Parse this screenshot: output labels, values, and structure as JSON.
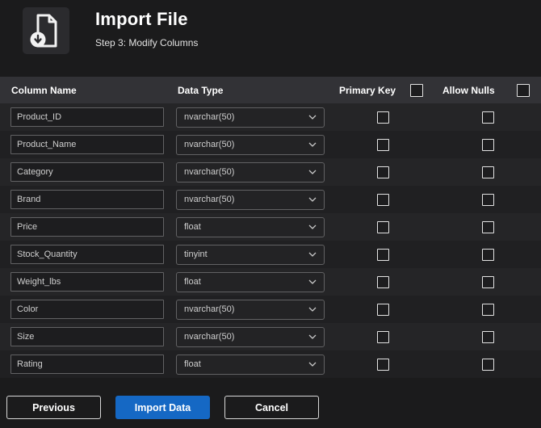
{
  "header": {
    "title": "Import File",
    "subtitle": "Step 3: Modify Columns",
    "icon": "import-file-icon"
  },
  "table": {
    "headers": {
      "column_name": "Column Name",
      "data_type": "Data Type",
      "primary_key": "Primary Key",
      "allow_nulls": "Allow Nulls"
    },
    "select_all": {
      "primary_key_checked": false,
      "allow_nulls_checked": false
    },
    "rows": [
      {
        "name": "Product_ID",
        "type": "nvarchar(50)",
        "primary_key": false,
        "allow_nulls": false
      },
      {
        "name": "Product_Name",
        "type": "nvarchar(50)",
        "primary_key": false,
        "allow_nulls": false
      },
      {
        "name": "Category",
        "type": "nvarchar(50)",
        "primary_key": false,
        "allow_nulls": false
      },
      {
        "name": "Brand",
        "type": "nvarchar(50)",
        "primary_key": false,
        "allow_nulls": false
      },
      {
        "name": "Price",
        "type": "float",
        "primary_key": false,
        "allow_nulls": false
      },
      {
        "name": "Stock_Quantity",
        "type": "tinyint",
        "primary_key": false,
        "allow_nulls": false
      },
      {
        "name": "Weight_lbs",
        "type": "float",
        "primary_key": false,
        "allow_nulls": false
      },
      {
        "name": "Color",
        "type": "nvarchar(50)",
        "primary_key": false,
        "allow_nulls": false
      },
      {
        "name": "Size",
        "type": "nvarchar(50)",
        "primary_key": false,
        "allow_nulls": false
      },
      {
        "name": "Rating",
        "type": "float",
        "primary_key": false,
        "allow_nulls": false
      }
    ]
  },
  "footer": {
    "previous_label": "Previous",
    "import_label": "Import Data",
    "cancel_label": "Cancel"
  },
  "icons": {
    "header": "import-file-icon",
    "dropdown": "chevron-down-icon"
  },
  "colors": {
    "background": "#1b1b1c",
    "table_header_bg": "#323236",
    "row_odd": "#252527",
    "row_even": "#202022",
    "accent_blue": "#1568c4",
    "border_gray": "#626264"
  }
}
